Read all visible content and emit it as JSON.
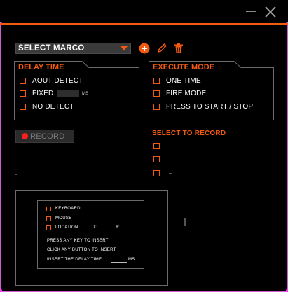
{
  "window": {
    "accent_color": "#f25a12",
    "frame_color": "#d25ad2",
    "icons": [
      "minimize-icon",
      "close-icon"
    ]
  },
  "toolbar": {
    "macro_select_value": "SELECT MARCO",
    "icons": [
      "add-icon",
      "pencil-icon",
      "trash-icon"
    ]
  },
  "delay_time": {
    "title": "DELAY TIME",
    "options": [
      {
        "label": "AOUT DETECT",
        "checked": false
      },
      {
        "label": "FIXED",
        "checked": false
      },
      {
        "label": "NO DETECT",
        "checked": false
      }
    ],
    "fixed_unit": "MS"
  },
  "execute_mode": {
    "title": "EXECUTE MODE",
    "options": [
      {
        "label": "ONE TIME",
        "checked": false
      },
      {
        "label": "FIRE MODE",
        "checked": false
      },
      {
        "label": "PRESS TO START / STOP",
        "checked": false
      }
    ]
  },
  "record": {
    "label": "RECORD",
    "status_color": "#ff1e1e"
  },
  "select_to_record": {
    "title": "SELECT TO RECORD",
    "checkboxes": [
      false,
      false,
      false
    ]
  },
  "insert_panel": {
    "options": [
      {
        "label": "KEYBOARD",
        "checked": false
      },
      {
        "label": "MOUSE",
        "checked": false
      },
      {
        "label": "LOCATION",
        "checked": false
      }
    ],
    "x_label": "X:",
    "y_label": "Y:",
    "line1": "PRESS ANY KEY TO INSERT",
    "line2": "CLICK ANY BUTTON TO INSERT",
    "line3": "INSERT THE DELAY TIME :",
    "line3_unit": "MS"
  }
}
